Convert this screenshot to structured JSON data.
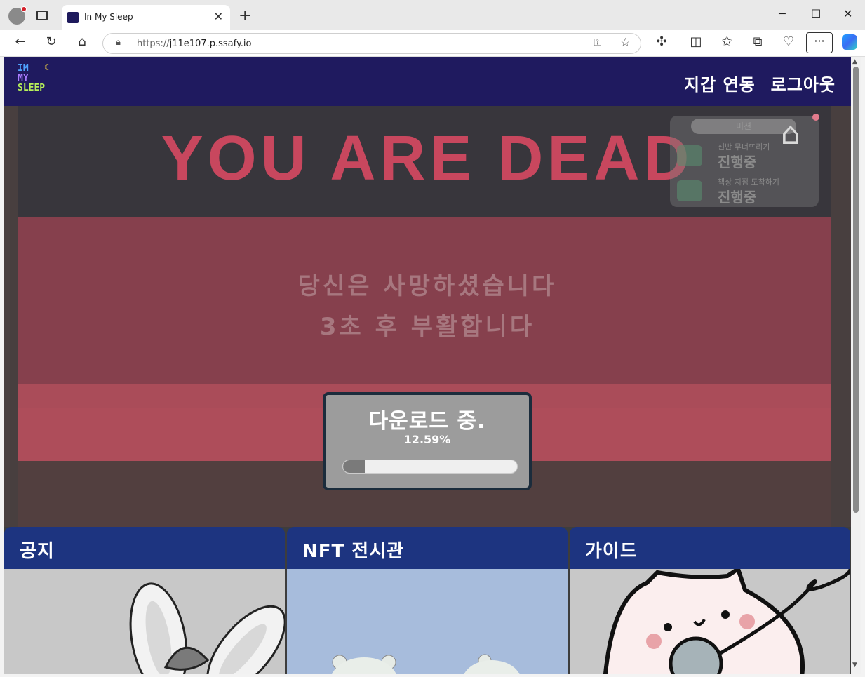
{
  "browser": {
    "tab_title": "In My Sleep",
    "url_proto": "https://",
    "url_host": "j11e107.p.ssafy.io"
  },
  "site": {
    "logo": {
      "line1": "IM",
      "line2": "MY",
      "line3": "SLEEP"
    },
    "nav": [
      {
        "label": "지갑 연동"
      },
      {
        "label": "로그아웃"
      }
    ]
  },
  "game": {
    "dead_title": "YOU ARE DEAD",
    "dead_line1": "당신은 사망하셨습니다",
    "dead_line2": "3초 후 부활합니다",
    "mission": {
      "title": "미션",
      "items": [
        {
          "text": "선반 무너뜨리기",
          "status": "진행중"
        },
        {
          "text": "책상 지점 도착하기",
          "status": "진행중"
        }
      ]
    },
    "download": {
      "title": "다운로드 중.",
      "percent_text": "12.59%",
      "progress": 0.1259
    }
  },
  "cards": [
    {
      "title": "공지",
      "bg": "#c8c8c8"
    },
    {
      "title": "NFT 전시관",
      "bg": "#a7bcdc"
    },
    {
      "title": "가이드",
      "bg": "#c8c8c8"
    }
  ]
}
